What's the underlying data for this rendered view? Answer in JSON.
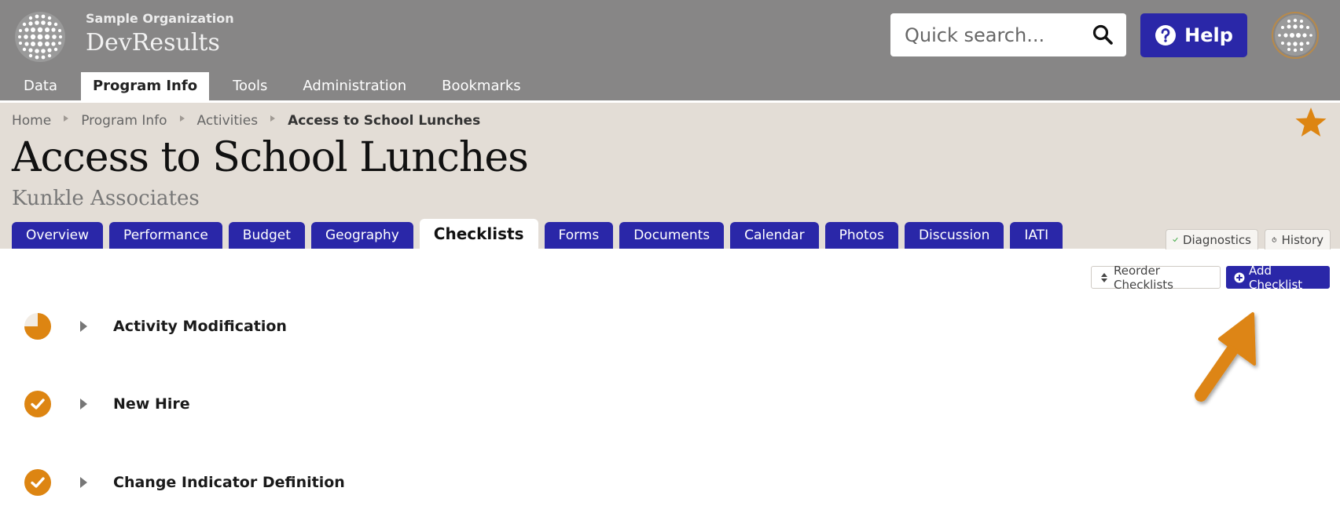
{
  "header": {
    "org_name": "Sample Organization",
    "app_name": "DevResults",
    "search_placeholder": "Quick search...",
    "help_label": "Help"
  },
  "main_nav": [
    {
      "label": "Data",
      "active": false
    },
    {
      "label": "Program Info",
      "active": true
    },
    {
      "label": "Tools",
      "active": false
    },
    {
      "label": "Administration",
      "active": false
    },
    {
      "label": "Bookmarks",
      "active": false
    }
  ],
  "breadcrumb": {
    "items": [
      "Home",
      "Program Info",
      "Activities"
    ],
    "current": "Access to School Lunches"
  },
  "page": {
    "title": "Access to School Lunches",
    "subtitle": "Kunkle Associates"
  },
  "tabs": [
    {
      "label": "Overview",
      "active": false
    },
    {
      "label": "Performance",
      "active": false
    },
    {
      "label": "Budget",
      "active": false
    },
    {
      "label": "Geography",
      "active": false
    },
    {
      "label": "Checklists",
      "active": true
    },
    {
      "label": "Forms",
      "active": false
    },
    {
      "label": "Documents",
      "active": false
    },
    {
      "label": "Calendar",
      "active": false
    },
    {
      "label": "Photos",
      "active": false
    },
    {
      "label": "Discussion",
      "active": false
    },
    {
      "label": "IATI",
      "active": false
    }
  ],
  "side_tabs": {
    "diagnostics": "Diagnostics",
    "history": "History"
  },
  "toolbar": {
    "reorder_label": "Reorder Checklists",
    "add_label": "Add Checklist"
  },
  "checklists": [
    {
      "name": "Activity Modification",
      "status": "partial",
      "progress": 0.75
    },
    {
      "name": "New Hire",
      "status": "complete",
      "progress": 1.0
    },
    {
      "name": "Change Indicator Definition",
      "status": "complete",
      "progress": 1.0
    }
  ],
  "colors": {
    "header_bg": "#878686",
    "accent_blue": "#2a27a8",
    "accent_orange": "#dd8512",
    "page_head_bg": "#e3ddd6"
  }
}
